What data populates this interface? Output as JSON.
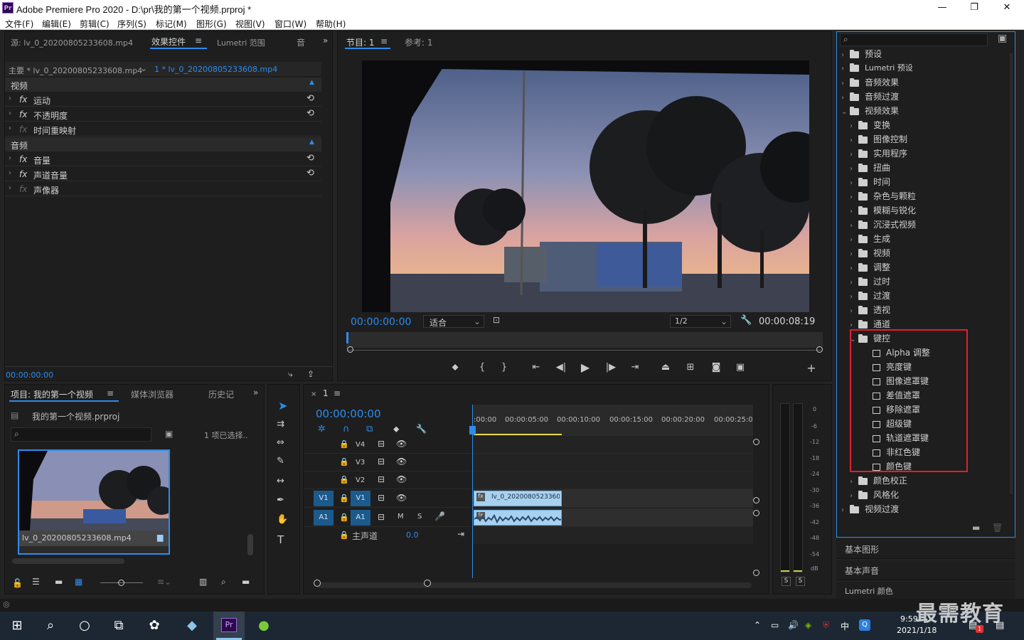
{
  "window": {
    "title": "Adobe Premiere Pro 2020 - D:\\pr\\我的第一个视频.prproj *",
    "logo": "Pr",
    "minimize": "—",
    "maximize": "❐",
    "close": "✕"
  },
  "menu": [
    "文件(F)",
    "编辑(E)",
    "剪辑(C)",
    "序列(S)",
    "标记(M)",
    "图形(G)",
    "视图(V)",
    "窗口(W)",
    "帮助(H)"
  ],
  "effect_controls": {
    "tabs": [
      "源: lv_0_20200805233608.mp4",
      "效果控件",
      "Lumetri 范围",
      "音"
    ],
    "master_label": "主要 * lv_0_20200805233608.mp4",
    "clip_label": "1 * lv_0_20200805233608.mp4",
    "video_header": "视频",
    "video_items": [
      "运动",
      "不透明度",
      "时间重映射"
    ],
    "audio_header": "音频",
    "audio_items": [
      "音量",
      "声道音量",
      "声像器"
    ],
    "timecode": "00:00:00:00",
    "fx": "fx"
  },
  "program": {
    "tabs": [
      "节目: 1",
      "参考: 1"
    ],
    "timecode": "00:00:00:00",
    "fit": "适合",
    "resolution": "1/2",
    "duration": "00:00:08:19"
  },
  "project": {
    "tabs": [
      "项目: 我的第一个视频",
      "媒体浏览器",
      "历史记"
    ],
    "file": "我的第一个视频.prproj",
    "selected": "1 项已选择..",
    "clip_name": "lv_0_20200805233608.mp4"
  },
  "timeline": {
    "tab": "1",
    "timecode": "00:00:00:00",
    "ruler": [
      ":00:00",
      "00:00:05:00",
      "00:00:10:00",
      "00:00:15:00",
      "00:00:20:00",
      "00:00:25:0"
    ],
    "video_tracks": [
      "V4",
      "V3",
      "V2",
      "V1"
    ],
    "audio_tracks": [
      "A1"
    ],
    "master_label": "主声道",
    "master_value": "0.0",
    "clip_name": "lv_0_20200805233608.mp4",
    "source_v1": "V1",
    "source_a1": "A1",
    "m": "M",
    "s": "S"
  },
  "meter": {
    "ticks": [
      "0",
      "-6",
      "-12",
      "-18",
      "-24",
      "-30",
      "-36",
      "-42",
      "-48",
      "-54",
      "dB"
    ],
    "solo": [
      "S",
      "S"
    ]
  },
  "effects": {
    "top_items": [
      "预设",
      "Lumetri 预设",
      "音频效果",
      "音频过渡",
      "视频效果"
    ],
    "video_effect_folders": [
      "变换",
      "图像控制",
      "实用程序",
      "扭曲",
      "时间",
      "杂色与颗粒",
      "模糊与锐化",
      "沉浸式视频",
      "生成",
      "视频",
      "调整",
      "过时",
      "过渡",
      "透视",
      "通道",
      "键控"
    ],
    "keying_items": [
      "Alpha 调整",
      "亮度键",
      "图像遮罩键",
      "差值遮罩",
      "移除遮罩",
      "超级键",
      "轨道遮罩键",
      "非红色键",
      "颜色键"
    ],
    "after_items": [
      "颜色校正",
      "风格化"
    ],
    "last_item": "视频过渡",
    "panels": [
      "基本图形",
      "基本声音",
      "Lumetri 颜色"
    ],
    "highlight_color": "#e0202a"
  },
  "taskbar": {
    "time": "9:59",
    "date": "2021/1/18",
    "ime": "中",
    "watermark": "最需教育",
    "badge": "1"
  }
}
